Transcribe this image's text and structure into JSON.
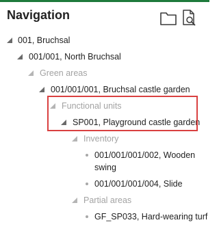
{
  "header": {
    "title": "Navigation"
  },
  "tree": {
    "n1": "001, Bruchsal",
    "n2": "001/001, North Bruchsal",
    "n3": "Green areas",
    "n4": "001/001/001, Bruchsal castle garden",
    "n5": "Functional units",
    "n6": "SP001, Playground castle garden",
    "n7": "Inventory",
    "n8_line1": "001/001/001/002, Wooden",
    "n8_line2": "swing",
    "n9": "001/001/001/004, Slide",
    "n10": "Partial areas",
    "n11": "GF_SP033, Hard-wearing turf"
  },
  "icons": {
    "folder": "folder-icon",
    "search_document": "document-search-icon"
  },
  "colors": {
    "accent_line": "#1e7a3c",
    "highlight_border": "#d94040",
    "muted_text": "#a3a3a3"
  }
}
